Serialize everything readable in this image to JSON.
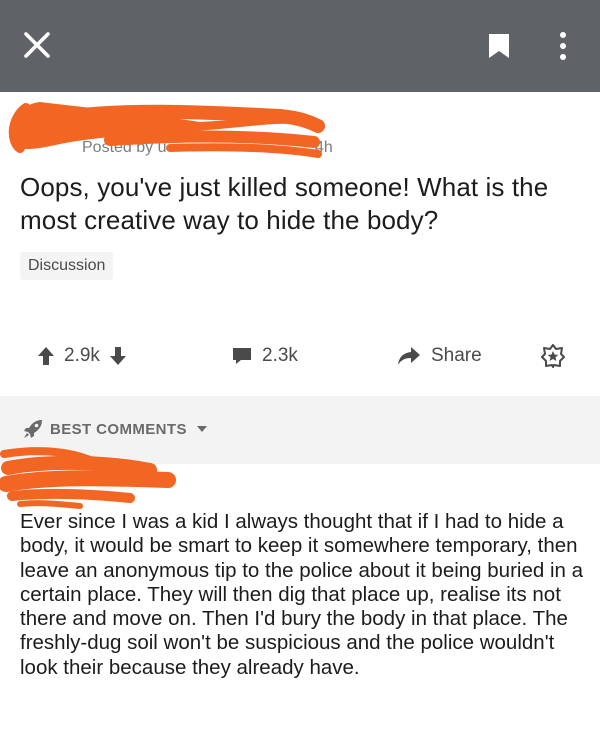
{
  "header": {
    "close_icon": "close-icon",
    "bookmark_icon": "bookmark-icon",
    "more_icon": "more-vertical-icon",
    "background_color": "#5f6368"
  },
  "post": {
    "posted_by_prefix": "Posted by u",
    "age": "4h",
    "title": "Oops, you've just killed someone! What is the most creative way to hide the body?",
    "flair": "Discussion",
    "votes": "2.9k",
    "comments": "2.3k",
    "share_label": "Share",
    "redaction_color": "#f26522"
  },
  "sort": {
    "label": "BEST COMMENTS"
  },
  "comment": {
    "body": "Ever since I was a kid I always thought that if I had to hide a body, it would be smart to keep it somewhere temporary, then leave an anonymous tip to the police about it being buried in a certain place. They will then dig that place up, realise its not there and move on. Then I'd bury the body in that place. The freshly-dug soil won't be suspicious and the police wouldn't look their because they already have."
  }
}
